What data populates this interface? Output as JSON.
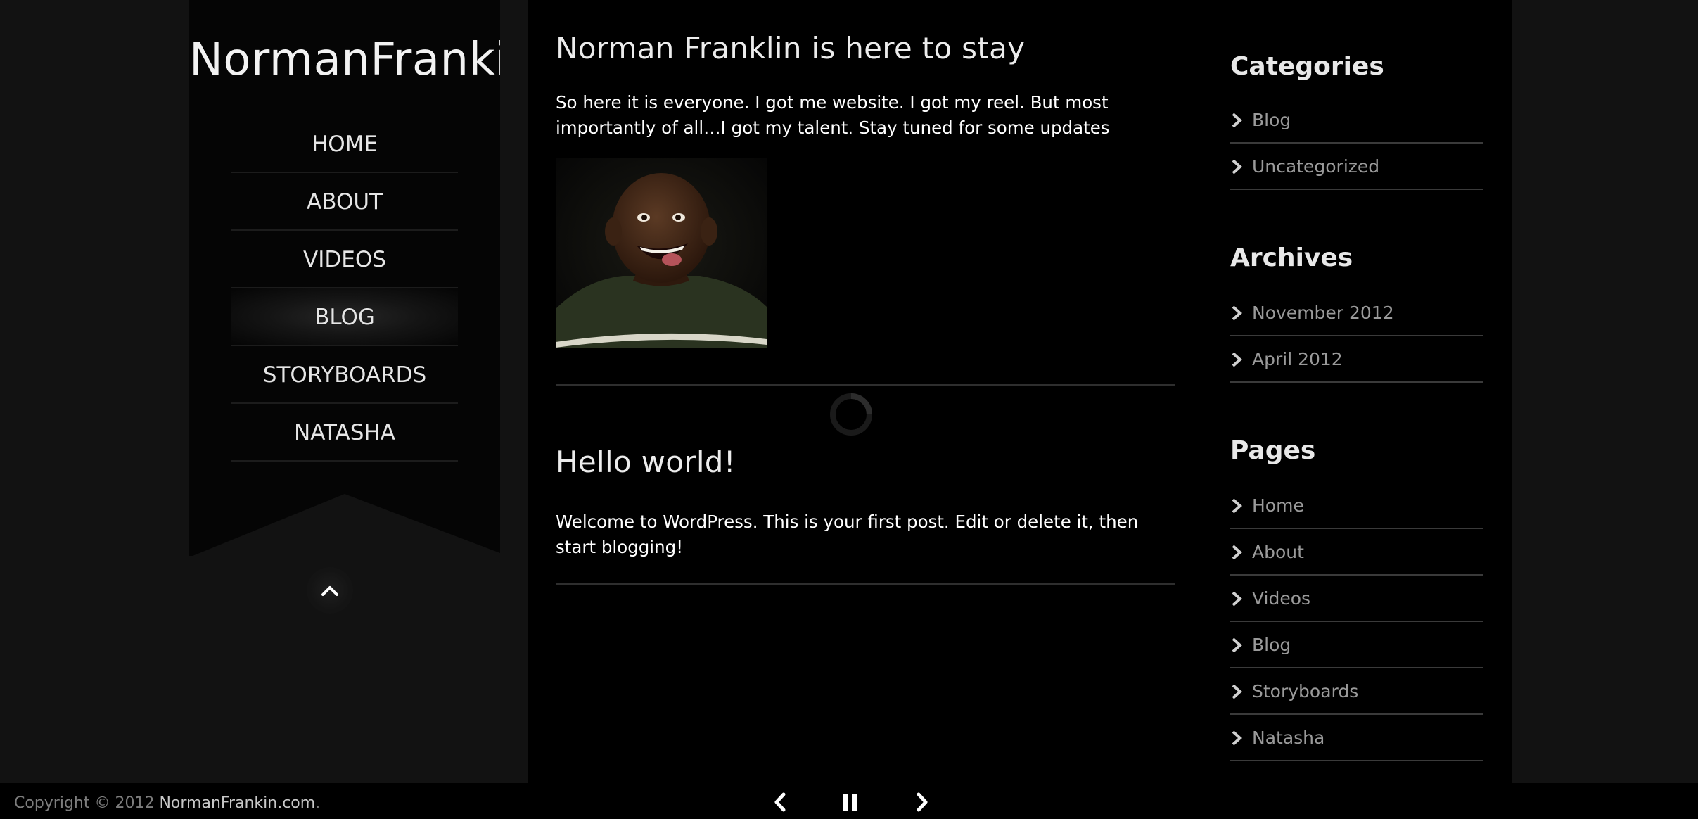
{
  "site": {
    "title": "NormanFrankin"
  },
  "nav": {
    "items": [
      {
        "label": "HOME"
      },
      {
        "label": "ABOUT"
      },
      {
        "label": "VIDEOS"
      },
      {
        "label": "BLOG"
      },
      {
        "label": "STORYBOARDS"
      },
      {
        "label": "NATASHA"
      }
    ],
    "active_index": 3
  },
  "posts": [
    {
      "title": "Norman Franklin is here to stay",
      "body": "So here it is everyone. I got me website. I got my reel. But most importantly of all…I got my talent. Stay tuned for some updates",
      "has_image": true
    },
    {
      "title": "Hello world!",
      "body": "Welcome to WordPress. This is your first post. Edit or delete it, then start blogging!"
    }
  ],
  "widgets": {
    "categories": {
      "title": "Categories",
      "items": [
        "Blog",
        "Uncategorized"
      ]
    },
    "archives": {
      "title": "Archives",
      "items": [
        "November 2012",
        "April 2012"
      ]
    },
    "pages": {
      "title": "Pages",
      "items": [
        "Home",
        "About",
        "Videos",
        "Blog",
        "Storyboards",
        "Natasha"
      ]
    }
  },
  "footer": {
    "copyright_prefix": "Copyright © 2012 ",
    "copyright_site": "NormanFrankin.com",
    "copyright_suffix": "."
  },
  "icons": {
    "widget_bullet": "chevron-right-icon",
    "back_to_top": "chevron-up-icon",
    "slideshow_prev": "chevron-left-icon",
    "slideshow_pause": "pause-icon",
    "slideshow_next": "chevron-right-icon",
    "loading": "spinner-icon"
  },
  "colors": {
    "page_bg": "#121212",
    "content_bg": "#000000",
    "sidebar_bg": "#050505",
    "link_muted": "#9a9a9a"
  }
}
